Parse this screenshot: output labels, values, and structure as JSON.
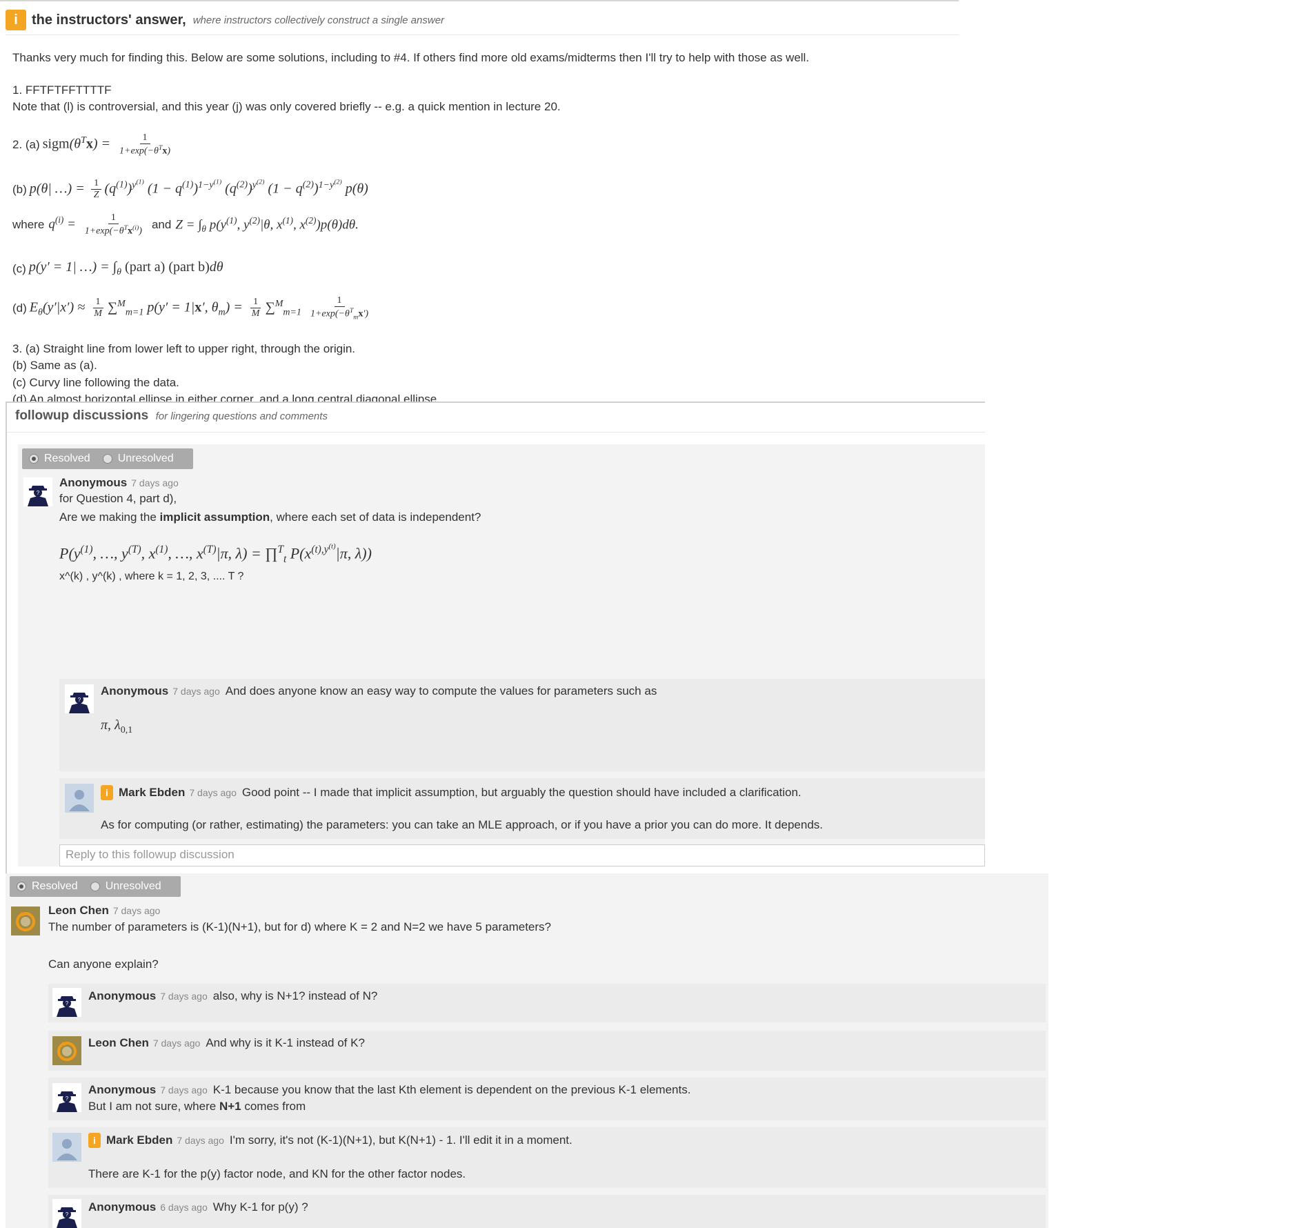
{
  "instructor_answer": {
    "badge": "i",
    "title": "the instructors' answer,",
    "subtitle": "where instructors collectively construct a single answer",
    "intro": "Thanks very much for finding this. Below are some solutions, including to #4. If others find more old exams/midterms then I'll try to help with those as well.",
    "q1": "1. FFTFTFFTTTTF",
    "q1_note": "Note that (l) is controversial, and this year (j) was only covered briefly -- e.g. a quick mention in lecture 20.",
    "q2a_label": "2. (a)",
    "q2b_label": "(b)",
    "q2_where": "where",
    "q2_and": "and",
    "q2c_label": "(c)",
    "q2d_label": "(d)",
    "q3a": "3. (a) Straight line from lower left to upper right, through the origin.",
    "q3b": "(b) Same as (a).",
    "q3c": "(c) Curvy line following the data.",
    "q3d": "(d) An almost horizontal ellipse in either corner, and a long central diagonal ellipse."
  },
  "followup": {
    "title": "followup discussions",
    "subtitle": "for lingering questions and comments",
    "resolved_label": "Resolved",
    "unresolved_label": "Unresolved",
    "reply_placeholder": "Reply to this followup discussion",
    "thread1": {
      "author": "Anonymous",
      "time": "7 days ago",
      "line1": "for Question 4, part d),",
      "line2_pre": "Are we making the",
      "line2_bold": "implicit assumption",
      "line2_post": ", where each set of data is independent?",
      "line3": "x^(k) , y^(k) ,  where k = 1, 2, 3, .... T ?",
      "replies": [
        {
          "author": "Anonymous",
          "time": "7 days ago",
          "text": "And does anyone know an easy way to compute the values for parameters such as"
        },
        {
          "author": "Mark Ebden",
          "time": "7 days ago",
          "text": "Good point -- I made that implicit assumption, but arguably the question should have included a clarification.",
          "text2": "As for computing (or rather, estimating) the parameters: you can take an MLE approach, or if you have a prior you can do more. It depends."
        }
      ]
    },
    "thread2": {
      "author": "Leon Chen",
      "time": "7 days ago",
      "line1": "The number of parameters is (K-1)(N+1), but for d) where K = 2 and N=2 we have 5 parameters?",
      "line2": "Can anyone explain?",
      "replies": [
        {
          "author": "Anonymous",
          "time": "7 days ago",
          "text": "also, why is N+1? instead of N?"
        },
        {
          "author": "Leon Chen",
          "time": "7 days ago",
          "text": "And why is it K-1 instead of K?"
        },
        {
          "author": "Anonymous",
          "time": "7 days ago",
          "text": "K-1 because you know that the last Kth element is dependent on the previous K-1 elements.",
          "text2_pre": "But I am not sure, where",
          "text2_bold": "N+1",
          "text2_post": "comes from"
        },
        {
          "author": "Mark Ebden",
          "time": "7 days ago",
          "text": "I'm sorry, it's not (K-1)(N+1), but K(N+1) - 1. I'll edit it in a moment.",
          "text2": "There are K-1 for the p(y) factor node, and KN for the other factor nodes."
        },
        {
          "author": "Anonymous",
          "time": "6 days ago",
          "text": "Why K-1 for p(y) ?"
        }
      ]
    }
  }
}
